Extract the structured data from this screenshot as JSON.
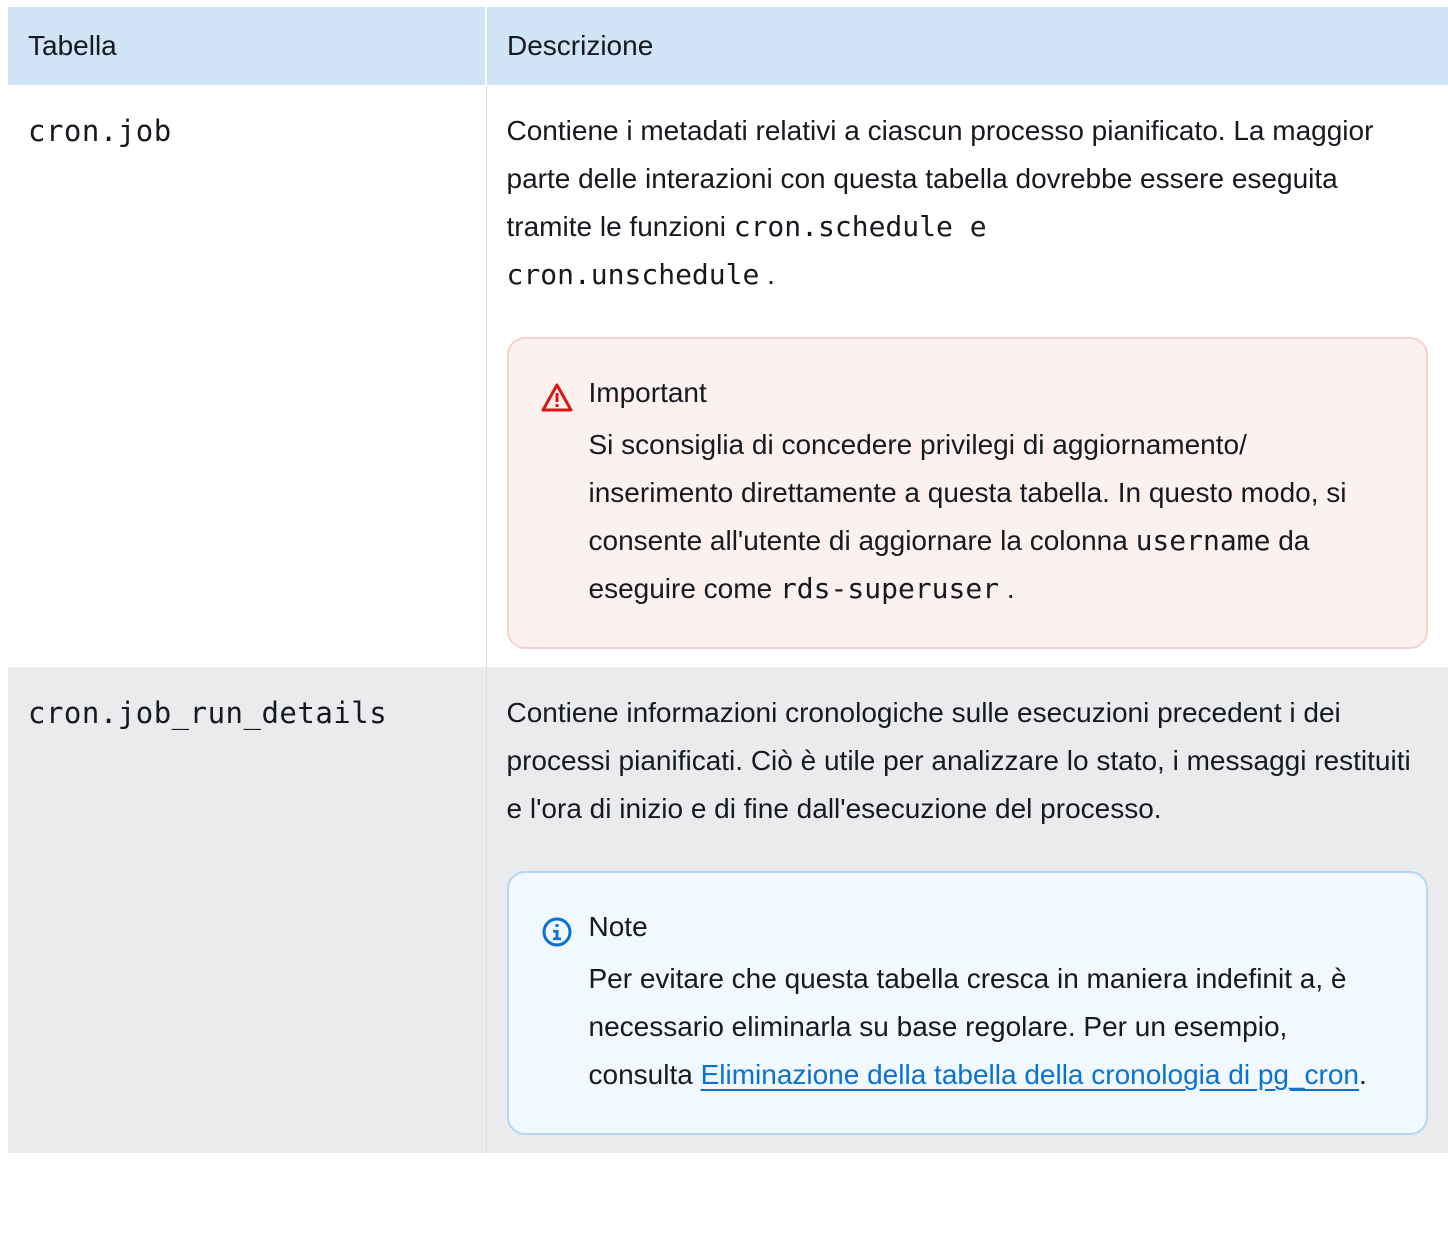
{
  "table": {
    "headers": [
      "Tabella",
      "Descrizione"
    ],
    "rows": [
      {
        "name": "cron.job",
        "desc_part1": "Contiene i metadati relativi a ciascun processo pianificato. La maggior parte delle interazioni con questa tabella dovrebbe essere eseguita tramite le funzioni ",
        "desc_code1": "cron.schedule",
        "desc_part2": " e",
        "desc_code2": "cron.unschedule",
        "desc_part3": " .",
        "callout": {
          "type": "warning",
          "icon": "warning-triangle-icon",
          "title": "Important",
          "body_part1": "Si sconsiglia di concedere privilegi di aggiornamento/ inserimento direttamente a questa tabella. In questo modo, si consente all'utente di aggiornare la colonna ",
          "body_code1": "username",
          "body_part2": " da eseguire come ",
          "body_code2": "rds-superuser",
          "body_part3": " ."
        }
      },
      {
        "name": "cron.job_run_details",
        "desc": "Contiene informazioni cronologiche sulle esecuzioni precedent i dei processi pianificati. Ciò è utile per analizzare lo stato, i messaggi restituiti e l'ora di inizio e di fine dall'esecuzione del processo.",
        "callout": {
          "type": "info",
          "icon": "info-circle-icon",
          "title": "Note",
          "body_part1": "Per evitare che questa tabella cresca in maniera indefinit a, è necessario eliminarla su base regolare. Per un esempio, consulta ",
          "link_text": "Eliminazione della tabella della cronologia di pg_cron",
          "body_part2": "."
        }
      }
    ]
  },
  "colors": {
    "header_bg": "#d1e4f6",
    "row_alt_bg": "#e9ebed",
    "warning_bg": "#fdf1f0",
    "warning_border": "#f7d1cd",
    "warning_icon": "#d91515",
    "info_bg": "#f1f8ff",
    "info_border": "#b5d6f4",
    "info_icon": "#0972d3",
    "link": "#0972d3"
  }
}
